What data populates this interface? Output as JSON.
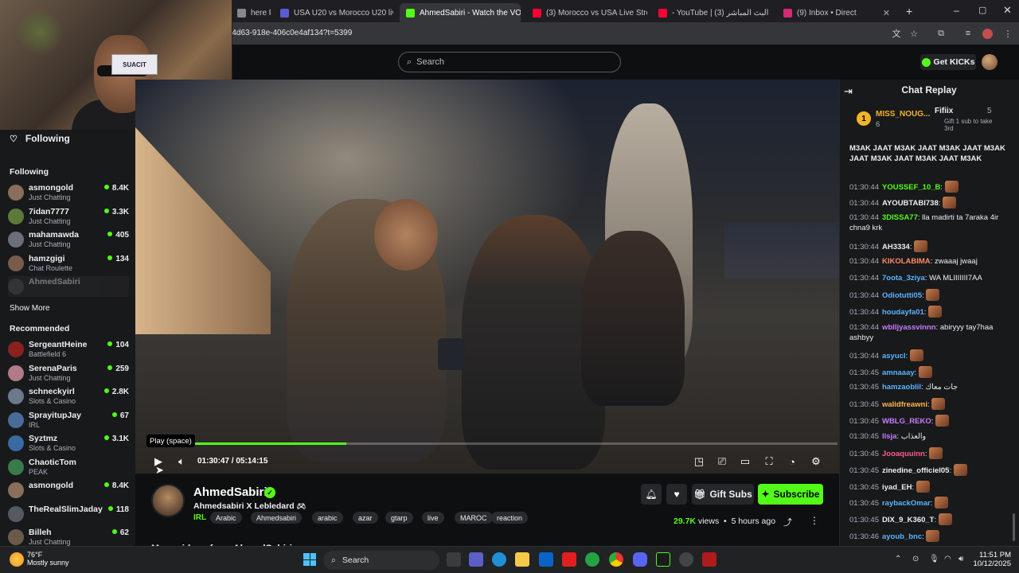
{
  "browser": {
    "tabs": [
      {
        "label": "here F",
        "favicon_color": "#888888"
      },
      {
        "label": "USA U20 vs Morocco U20 live",
        "favicon_color": "#5b5bd6"
      },
      {
        "label": "AhmedSabiri - Watch the VOD",
        "favicon_color": "#53fc18"
      },
      {
        "label": "(3) Morocco vs USA Live Stream",
        "favicon_color": "#ff0033"
      },
      {
        "label": "- YouTube | البث المباشر (3)",
        "favicon_color": "#ff0033"
      },
      {
        "label": "(9) Inbox • Direct",
        "favicon_color": "#d62976"
      }
    ],
    "new_tab": "+",
    "url": "-4d63-918e-406c0e4af134?t=5399"
  },
  "header": {
    "search_placeholder": "Search",
    "get_kicks": "Get KICKs"
  },
  "webcam": {
    "card_text": "SUACIT"
  },
  "sidebar": {
    "following_heading": "Following",
    "following_section": "Following",
    "following": [
      {
        "name": "asmongold",
        "category": "Just Chatting",
        "viewers": "8.4K",
        "color": "#8a6d5a"
      },
      {
        "name": "7idan7777",
        "category": "Just Chatting",
        "viewers": "3.3K",
        "color": "#5b7a3a"
      },
      {
        "name": "mahamawda",
        "category": "Just Chatting",
        "viewers": "405",
        "color": "#6a6f7a"
      },
      {
        "name": "hamzgigi",
        "category": "Chat Roulette",
        "viewers": "134",
        "color": "#7a5a4a"
      },
      {
        "name": "AhmedSabiri",
        "category": "",
        "viewers": "",
        "color": "#555555"
      }
    ],
    "show_more": "Show More",
    "recommended_heading": "Recommended",
    "recommended": [
      {
        "name": "SergeantHeine",
        "category": "Battlefield 6",
        "viewers": "104",
        "color": "#8a2020"
      },
      {
        "name": "SerenaParis",
        "category": "Just Chatting",
        "viewers": "259",
        "color": "#b07a8a"
      },
      {
        "name": "schneckyirl",
        "category": "Slots & Casino",
        "viewers": "2.8K",
        "color": "#6a7a8a"
      },
      {
        "name": "SprayitupJay",
        "category": "IRL",
        "viewers": "67",
        "color": "#4a6a9a"
      },
      {
        "name": "Syztmz",
        "category": "Slots & Casino",
        "viewers": "3.1K",
        "color": "#3a6aa0"
      },
      {
        "name": "ChaoticTom",
        "category": "PEAK",
        "viewers": "",
        "color": "#3a7a4a"
      },
      {
        "name": "asmongold",
        "category": "",
        "viewers": "8.4K",
        "color": "#8a6d5a"
      },
      {
        "name": "TheRealSlimJaday",
        "category": "",
        "viewers": "118",
        "color": "#555a60"
      },
      {
        "name": "Billeh",
        "category": "Just Chatting",
        "viewers": "62",
        "color": "#6a5a4a"
      }
    ]
  },
  "player": {
    "tooltip": "Play (space)",
    "current_time": "01:30:47",
    "duration": "05:14:15",
    "progress_fraction": 0.288
  },
  "stream": {
    "streamer": "AhmedSabiri",
    "title": "Ahmedsabiri X Lebledard",
    "category": "IRL",
    "tags": [
      "Arabic",
      "Ahmedsabiri",
      "arabic",
      "azar",
      "gtarp",
      "live",
      "MAROC",
      "reaction"
    ],
    "gift_subs": "Gift Subs",
    "subscribe": "Subscribe",
    "views": "29.7K",
    "views_label": "views",
    "ago": "5 hours ago",
    "more_videos": "More videos from AhmedSabiri"
  },
  "chat": {
    "title": "Chat Replay",
    "pinned": [
      {
        "rank": "1",
        "name": "MISS_NOUG...",
        "count": "6"
      },
      {
        "name": "Fifiix",
        "count": "5",
        "note": "Gift 1 sub to take 3rd"
      }
    ],
    "top_text": "M3AK JAAT M3AK JAAT M3AK JAAT M3AK JAAT M3AK JAAT M3AK JAAT M3AK",
    "messages": [
      {
        "time": "01:30:44",
        "user": "YOUSSEF_10_B",
        "color": "#53fc18",
        "text": "",
        "emote": true
      },
      {
        "time": "01:30:44",
        "user": "AYOUBTABI738",
        "color": "#efeff1",
        "text": "",
        "emote": true
      },
      {
        "time": "01:30:44",
        "user": "3DISSA77",
        "color": "#53fc18",
        "text": "lla madirti ta 7araka 4ir chna9 krk",
        "emote": false
      },
      {
        "time": "01:30:44",
        "user": "AH3334",
        "color": "#efeff1",
        "text": "",
        "emote": true
      },
      {
        "time": "01:30:44",
        "user": "KIKOLABIMA",
        "color": "#ff8a65",
        "text": "zwaaaj jwaaj",
        "emote": false
      },
      {
        "time": "01:30:44",
        "user": "7oota_3ziya",
        "color": "#5ab4ff",
        "text": "WA MLIIIIIII7AA",
        "emote": false
      },
      {
        "time": "01:30:44",
        "user": "Odiotutti05",
        "color": "#5ab4ff",
        "text": "",
        "emote": true
      },
      {
        "time": "01:30:44",
        "user": "houdayfa01",
        "color": "#5ab4ff",
        "text": "",
        "emote": true
      },
      {
        "time": "01:30:44",
        "user": "wblljyassvinnn",
        "color": "#c77dff",
        "text": "abiryyy tay7haa ashbyy",
        "emote": false
      },
      {
        "time": "01:30:44",
        "user": "asyucl",
        "color": "#5ab4ff",
        "text": "",
        "emote": true
      },
      {
        "time": "01:30:45",
        "user": "amnaaay",
        "color": "#5ab4ff",
        "text": "",
        "emote": true
      },
      {
        "time": "01:30:45",
        "user": "hamzaoblil",
        "color": "#5ab4ff",
        "text": "جات معاك",
        "emote": false
      },
      {
        "time": "01:30:45",
        "user": "walidfreawni",
        "color": "#ffb74d",
        "text": "",
        "emote": true
      },
      {
        "time": "01:30:45",
        "user": "WBLG_REKO",
        "color": "#c77dff",
        "text": "",
        "emote": true
      },
      {
        "time": "01:30:45",
        "user": "llsja",
        "color": "#c77dff",
        "text": "والعذاب",
        "emote": false
      },
      {
        "time": "01:30:45",
        "user": "Jooaquuinn",
        "color": "#ff5c8a",
        "text": "",
        "emote": true
      },
      {
        "time": "01:30:45",
        "user": "zinedine_officiel05",
        "color": "#efeff1",
        "text": "",
        "emote": true
      },
      {
        "time": "01:30:45",
        "user": "iyad_EH",
        "color": "#efeff1",
        "text": "",
        "emote": true
      },
      {
        "time": "01:30:45",
        "user": "raybackOmar",
        "color": "#5ab4ff",
        "text": "",
        "emote": true
      },
      {
        "time": "01:30:45",
        "user": "DIX_9_K360_T",
        "color": "#efeff1",
        "text": "",
        "emote": true
      },
      {
        "time": "01:30:46",
        "user": "ayoub_bnc",
        "color": "#5ab4ff",
        "text": "",
        "emote": true
      }
    ]
  },
  "taskbar": {
    "weather_temp": "76°F",
    "weather_desc": "Mostly sunny",
    "search": "Search",
    "time": "11:51 PM",
    "date": "10/12/2025"
  }
}
